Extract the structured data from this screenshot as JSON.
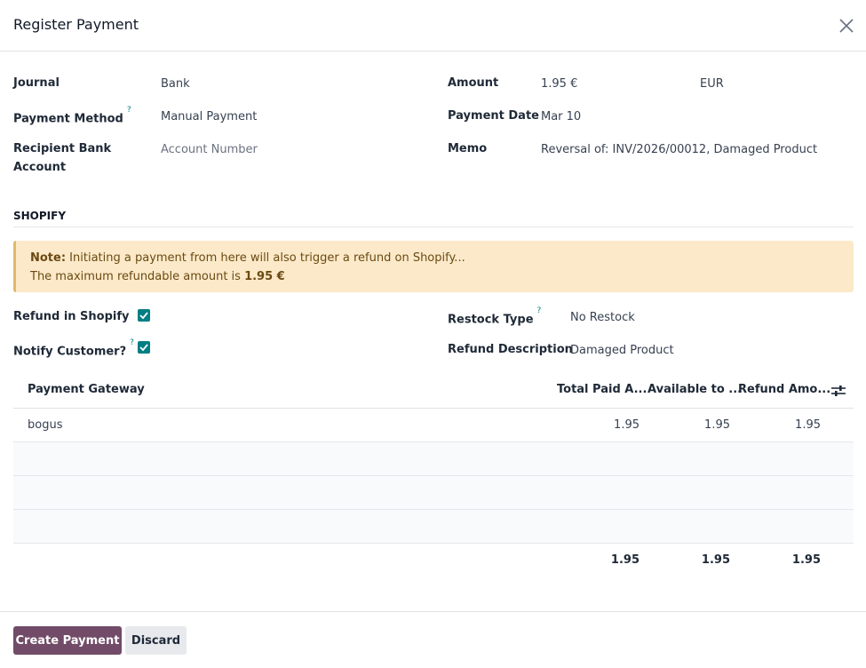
{
  "dialog": {
    "title": "Register Payment"
  },
  "form": {
    "journal_label": "Journal",
    "journal_value": "Bank",
    "payment_method_label": "Payment Method",
    "payment_method_help": "?",
    "payment_method_value": "Manual Payment",
    "recipient_label_line1": "Recipient Bank",
    "recipient_label_line2": "Account",
    "recipient_placeholder": "Account Number",
    "amount_label": "Amount",
    "amount_value": "1.95 €",
    "currency_value": "EUR",
    "payment_date_label": "Payment Date",
    "payment_date_value": "Mar 10",
    "memo_label": "Memo",
    "memo_value": "Reversal of: INV/2026/00012, Damaged Product"
  },
  "shopify": {
    "section_title": "SHOPIFY",
    "note_strong": "Note:",
    "note_text": " Initiating a payment from here will also trigger a refund on Shopify...",
    "note_line2_text": "The maximum refundable amount is ",
    "note_line2_amount": "1.95 €",
    "refund_label": "Refund in Shopify",
    "refund_checked": true,
    "notify_label": "Notify Customer?",
    "notify_help": "?",
    "notify_checked": true,
    "restock_label": "Restock Type",
    "restock_help": "?",
    "restock_value": "No Restock",
    "refund_desc_label": "Refund Description",
    "refund_desc_value": "Damaged Product"
  },
  "table": {
    "headers": {
      "gateway": "Payment Gateway",
      "total_paid": "Total Paid A...",
      "available": "Available to ...",
      "refund_amount": "Refund Amo..."
    },
    "rows": [
      {
        "gateway": "bogus",
        "total_paid": "1.95",
        "available": "1.95",
        "refund_amount": "1.95"
      }
    ],
    "totals": {
      "total_paid": "1.95",
      "available": "1.95",
      "refund_amount": "1.95"
    }
  },
  "footer": {
    "create_label": "Create Payment",
    "discard_label": "Discard"
  },
  "colors": {
    "primary": "#714b67",
    "accent": "#017e84",
    "note_bg": "#fbe9c9"
  },
  "icons": {
    "close": "close-icon",
    "settings": "column-settings-icon",
    "checkbox": "checkmark-icon"
  }
}
